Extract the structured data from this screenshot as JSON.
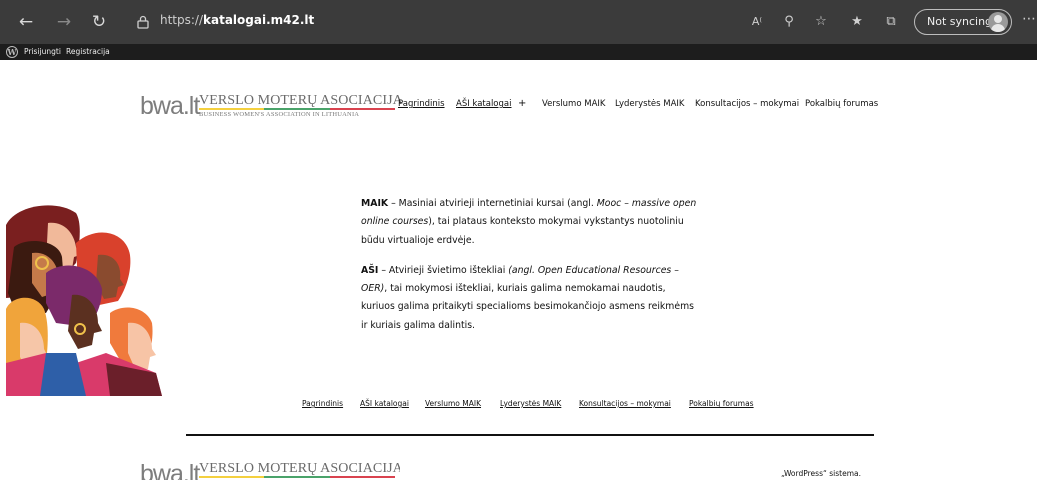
{
  "browser": {
    "url_prefix": "https://",
    "url_host": "katalogai.m42.lt",
    "sync_label": "Not syncing"
  },
  "adminbar": {
    "login": "Prisijungti",
    "register": "Registracija"
  },
  "logo": {
    "mark": "bwa.lt",
    "title": "VERSLO MOTERŲ ASOCIACIJA",
    "subtitle": "BUSINESS WOMEN'S ASSOCIATION IN LITHUANIA",
    "stripe_colors": [
      "#f4d03f",
      "#4aa36a",
      "#d9434f"
    ]
  },
  "nav": {
    "home": "Pagrindinis",
    "catalogs": "AŠI katalogai",
    "plus": "+",
    "business": "Verslumo MAIK",
    "leadership": "Lyderystės MAIK",
    "consult": "Konsultacijos – mokymai",
    "forums": "Pokalbių forumas"
  },
  "content": {
    "maik_term": "MAIK",
    "maik_text_1": " – Masiniai atvirieji internetiniai kursai (angl. ",
    "maik_italic": "Mooc – massive open online courses",
    "maik_text_2": "), tai plataus konteksto mokymai vykstantys nuotoliniu būdu virtualioje erdvėje.",
    "asi_term": "AŠI",
    "asi_text_1": " – Atvirieji švietimo ištekliai  ",
    "asi_italic": "(angl. Open Educational Resources – OER)",
    "asi_text_2": ", tai mokymosi ištekliai, kuriais galima nemokamai naudotis, kuriuos galima pritaikyti specialioms besimokančiojo asmens reikmėms ir kuriais galima dalintis."
  },
  "footer": {
    "powered": "„WordPress“ sistema."
  }
}
